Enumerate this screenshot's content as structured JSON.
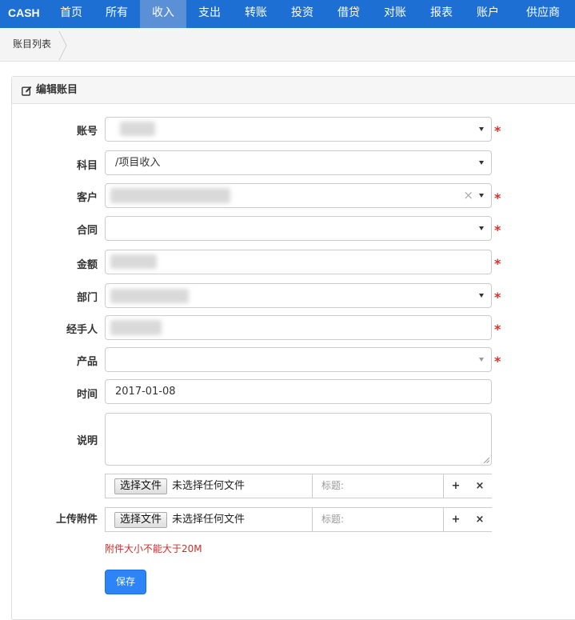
{
  "nav": {
    "brand": "CASH",
    "items": [
      {
        "label": "首页"
      },
      {
        "label": "所有"
      },
      {
        "label": "收入"
      },
      {
        "label": "支出"
      },
      {
        "label": "转账"
      },
      {
        "label": "投资"
      },
      {
        "label": "借贷"
      },
      {
        "label": "对账"
      },
      {
        "label": "报表"
      },
      {
        "label": "账户"
      },
      {
        "label": "供应商"
      }
    ],
    "active_item": "收入",
    "accent": "#1e6fd4"
  },
  "breadcrumb": {
    "label": "账目列表"
  },
  "panel": {
    "title": "编辑账目",
    "icon": "edit-icon"
  },
  "form": {
    "account_label": "账号",
    "subject_label": "科目",
    "subject_value": "/项目收入",
    "customer_label": "客户",
    "contract_label": "合同",
    "amount_label": "金额",
    "department_label": "部门",
    "handler_label": "经手人",
    "product_label": "产品",
    "time_label": "时间",
    "time_value": "2017-01-08",
    "description_label": "说明",
    "upload_label": "上传附件",
    "required_mark": "*",
    "clear_mark": "×"
  },
  "upload": {
    "rows": [
      {
        "button": "选择文件",
        "status": "未选择任何文件",
        "title_placeholder": "标题:"
      },
      {
        "button": "选择文件",
        "status": "未选择任何文件",
        "title_placeholder": "标题:"
      }
    ],
    "add_symbol": "+",
    "remove_symbol": "×",
    "hint": "附件大小不能大于20M",
    "hint_color": "#c9302c"
  },
  "actions": {
    "save": "保存",
    "save_color": "#2c84f7"
  }
}
